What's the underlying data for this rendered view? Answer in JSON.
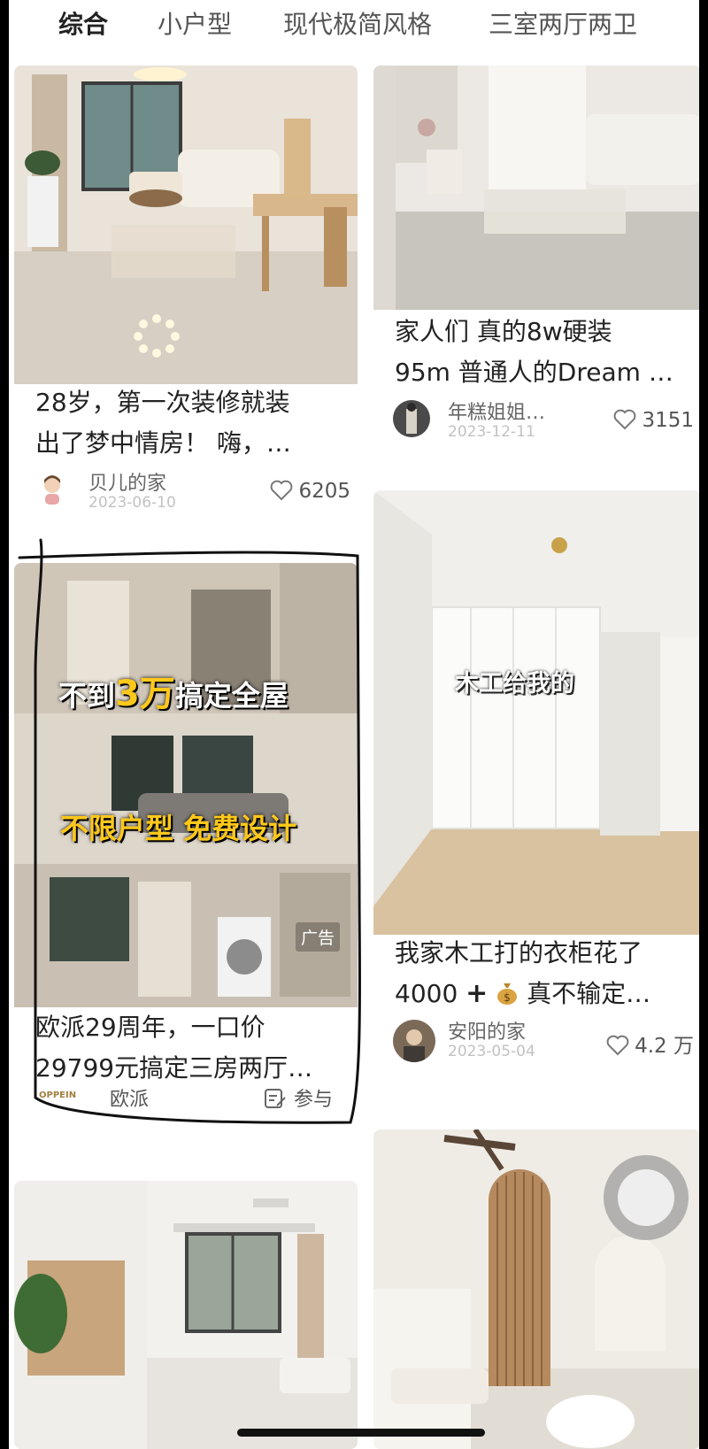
{
  "tabs": [
    {
      "label": "综合",
      "active": true
    },
    {
      "label": "小户型",
      "active": false
    },
    {
      "label": "现代极简风格",
      "active": false
    },
    {
      "label": "三室两厅两卫",
      "active": false
    }
  ],
  "cards": {
    "card1": {
      "title_line1": "28岁，第一次装修就装",
      "title_line2": "出了梦中情房！ 嗨，…",
      "author": "贝儿的家",
      "date": "2023-06-10",
      "likes": "6205"
    },
    "card2": {
      "title_line1": "家人们 真的8w硬装",
      "title_line2": "95m 普通人的Dream …",
      "author": "年糕姐姐…",
      "date": "2023-12-11",
      "likes": "3151"
    },
    "ad": {
      "overlay1_a": "不到",
      "overlay1_b": "3万",
      "overlay1_c": "搞定全屋",
      "overlay2": "不限户型 免费设计",
      "badge": "广告",
      "title_line1": "欧派29周年，一口价",
      "title_line2": "29799元搞定三房两厅…",
      "brand_logo": "OPPEIN",
      "brand": "欧派",
      "action": "参与"
    },
    "card4": {
      "overlay": "木工给我的",
      "title_line1": "我家木工打的衣柜花了",
      "title_line2_a": "4000",
      "title_line2_b": "真不输定…",
      "author": "安阳的家",
      "date": "2023-05-04",
      "likes": "4.2 万"
    }
  },
  "colors": {
    "accent_yellow": "#ffc81a",
    "annotation_ink": "#111111"
  },
  "icons": [
    "heart-icon",
    "money-bag-icon",
    "plus-icon",
    "participate-icon",
    "loading-dots-icon"
  ]
}
